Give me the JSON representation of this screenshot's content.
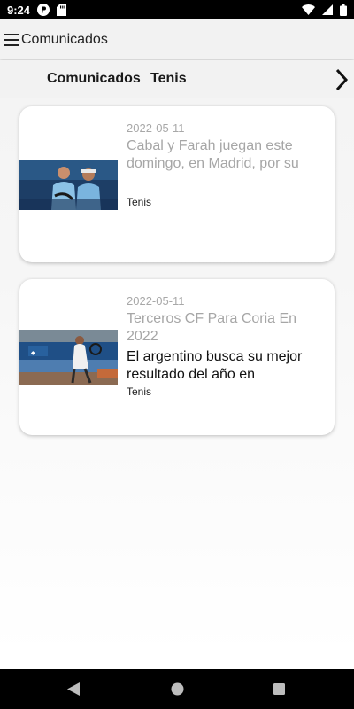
{
  "status_bar": {
    "time": "9:24",
    "left_icons": [
      "vpn-badge-icon",
      "sd-card-icon"
    ],
    "right_icons": [
      "wifi-icon",
      "signal-icon",
      "battery-icon"
    ]
  },
  "app_bar": {
    "menu_icon": "hamburger-menu-icon",
    "title": "Comunicados"
  },
  "tabs": {
    "items": [
      {
        "label": "Comunicados"
      },
      {
        "label": "Tenis"
      }
    ],
    "next_icon": "chevron-right-icon"
  },
  "articles": [
    {
      "date": "2022-05-11",
      "title": "Cabal y Farah juegan este domingo, en Madrid, por su",
      "summary": "",
      "tag": "Tenis",
      "thumbnail": "doubles-players-photo"
    },
    {
      "date": "2022-05-11",
      "title": "Terceros CF Para Coria En 2022",
      "summary": "El argentino busca su mejor resultado del año en",
      "tag": "Tenis",
      "thumbnail": "tennis-player-court-photo"
    }
  ],
  "nav_bar": {
    "icons": [
      "back-triangle-icon",
      "home-circle-icon",
      "recent-square-icon"
    ]
  },
  "colors": {
    "status_bar": "#000000",
    "app_bar": "#f2f2f2",
    "card_bg": "#ffffff",
    "muted_text": "#a6a6a6"
  }
}
